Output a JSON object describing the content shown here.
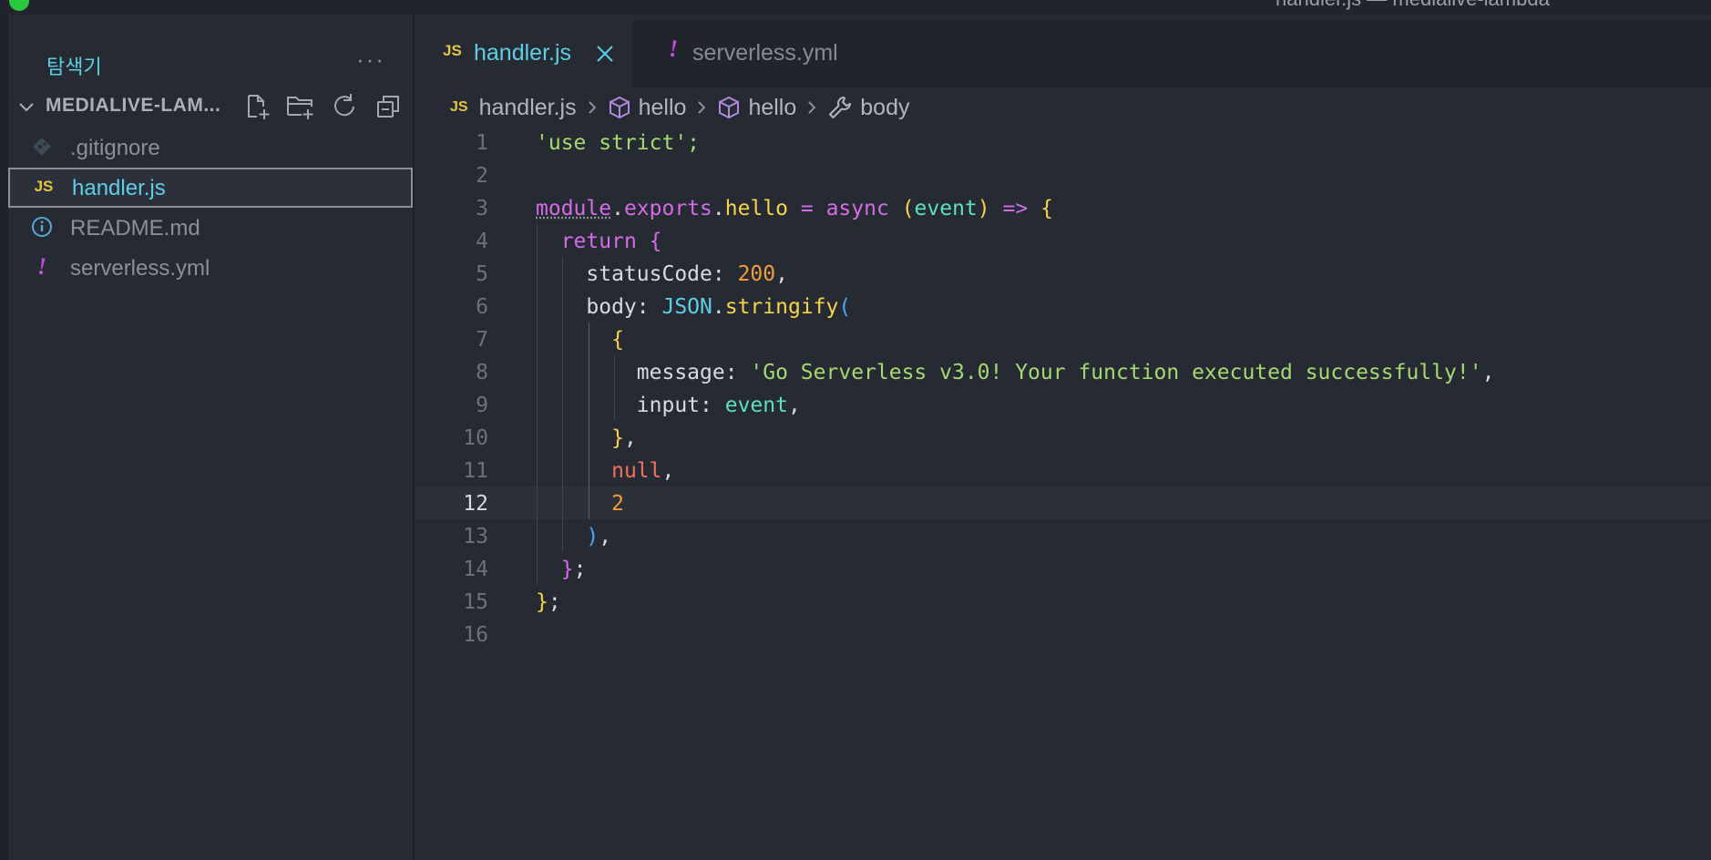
{
  "window": {
    "title": "handler.js — medialive-lambda"
  },
  "colors": {
    "accent": "#5ccfe6",
    "js_badge": "#e5c63f",
    "yaml_badge": "#c04de0"
  },
  "sidebar": {
    "title": "탐색기",
    "more_icon": "ellipsis-icon",
    "section_title": "MEDIALIVE-LAM...",
    "actions": [
      {
        "name": "new-file-icon"
      },
      {
        "name": "new-folder-icon"
      },
      {
        "name": "refresh-icon"
      },
      {
        "name": "collapse-all-icon"
      }
    ],
    "files": [
      {
        "label": ".gitignore",
        "icon": "git-icon",
        "selected": false
      },
      {
        "label": "handler.js",
        "icon": "js-icon",
        "badge": "JS",
        "selected": true
      },
      {
        "label": "README.md",
        "icon": "info-icon",
        "selected": false
      },
      {
        "label": "serverless.yml",
        "icon": "yaml-icon",
        "badge": "!",
        "selected": false
      }
    ]
  },
  "tabs": [
    {
      "label": "handler.js",
      "badge": "JS",
      "active": true
    },
    {
      "label": "serverless.yml",
      "badge": "!",
      "active": false
    }
  ],
  "breadcrumb": {
    "file": "handler.js",
    "file_badge": "JS",
    "items": [
      "hello",
      "hello",
      "body"
    ]
  },
  "editor": {
    "current_line": 12,
    "lines": [
      {
        "n": "1"
      },
      {
        "n": "2"
      },
      {
        "n": "3"
      },
      {
        "n": "4"
      },
      {
        "n": "5"
      },
      {
        "n": "6"
      },
      {
        "n": "7"
      },
      {
        "n": "8"
      },
      {
        "n": "9"
      },
      {
        "n": "10"
      },
      {
        "n": "11"
      },
      {
        "n": "12"
      },
      {
        "n": "13"
      },
      {
        "n": "14"
      },
      {
        "n": "15"
      },
      {
        "n": "16"
      }
    ],
    "code": {
      "l1": "'use strict';",
      "l3_module": "module",
      "l3_exports": "exports",
      "l3_hello": "hello",
      "l3_async": "async",
      "l3_event": "event",
      "l4_return": "return",
      "l5_key": "statusCode",
      "l5_val": "200",
      "l6_key": "body",
      "l6_json": "JSON",
      "l6_fn": "stringify",
      "l8_key": "message",
      "l8_val": "'Go Serverless v3.0! Your function executed successfully!'",
      "l9_key": "input",
      "l9_val": "event",
      "l11_val": "null",
      "l12_val": "2"
    }
  }
}
